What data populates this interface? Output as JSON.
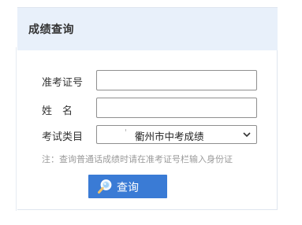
{
  "panel": {
    "title": "成绩查询"
  },
  "form": {
    "exam_id_label": "准考证号",
    "exam_id_value": "",
    "name_label": "姓　名",
    "name_value": "",
    "category_label": "考试类目",
    "category_selected": "衢州市中考成绩",
    "note": "注：查询普通话成绩时请在准考证号栏输入身份证"
  },
  "actions": {
    "query_label": "查询"
  },
  "colors": {
    "header_bg": "#e8f0fa",
    "button_bg": "#3a7bd5",
    "note_text": "#9a9a9a"
  }
}
